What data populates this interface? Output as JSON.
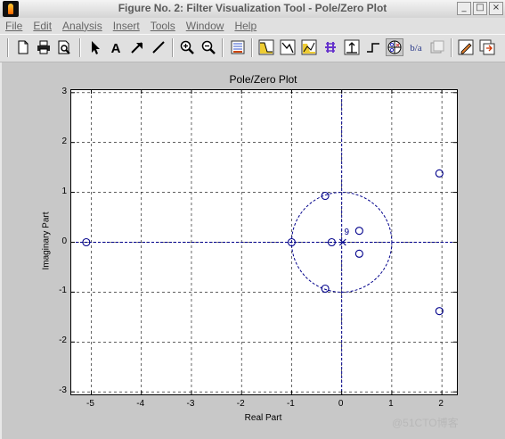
{
  "window": {
    "title": "Figure No. 2: Filter Visualization Tool - Pole/Zero Plot",
    "buttons": [
      "_",
      "□",
      "×"
    ]
  },
  "menu": [
    "File",
    "Edit",
    "Analysis",
    "Insert",
    "Tools",
    "Window",
    "Help"
  ],
  "toolbar": {
    "icons": [
      "new-file-icon",
      "print-icon",
      "print-preview-icon",
      "pointer-arrow-icon",
      "text-insert-icon",
      "arrow-insert-icon",
      "line-insert-icon",
      "zoom-in-icon",
      "zoom-out-icon",
      "fvtool-info-icon",
      "magnitude-response-icon",
      "phase-response-icon",
      "mag-phase-response-icon",
      "group-delay-icon",
      "impulse-response-icon",
      "step-response-icon",
      "pole-zero-icon",
      "filter-coefficients-icon",
      "filter-info-icon",
      "edit-filter-icon",
      "export-icon"
    ],
    "active": "pole-zero-icon"
  },
  "chart_data": {
    "type": "scatter",
    "title": "Pole/Zero Plot",
    "xlabel": "Real Part",
    "ylabel": "Imaginary Part",
    "xlim": [
      -5.4,
      2.3
    ],
    "ylim": [
      -3.05,
      3.05
    ],
    "xticks": [
      -5,
      -4,
      -3,
      -2,
      -1,
      0,
      1,
      2
    ],
    "yticks": [
      -3,
      -2,
      -1,
      0,
      1,
      2,
      3
    ],
    "grid": true,
    "unit_circle": true,
    "series": [
      {
        "marker": "circle",
        "points": [
          [
            -5.1,
            0
          ],
          [
            -1.0,
            0
          ],
          [
            -0.2,
            0
          ],
          [
            -0.33,
            0.93
          ],
          [
            -0.33,
            -0.93
          ],
          [
            0.35,
            0.23
          ],
          [
            0.35,
            -0.23
          ],
          [
            1.95,
            1.38
          ],
          [
            1.95,
            -1.38
          ]
        ]
      },
      {
        "marker": "x",
        "points": [
          [
            0.02,
            0
          ]
        ]
      }
    ],
    "annotations": [
      {
        "text": "9",
        "x": 0.05,
        "y": 0.15
      }
    ]
  },
  "watermark": "@51CTO博客"
}
